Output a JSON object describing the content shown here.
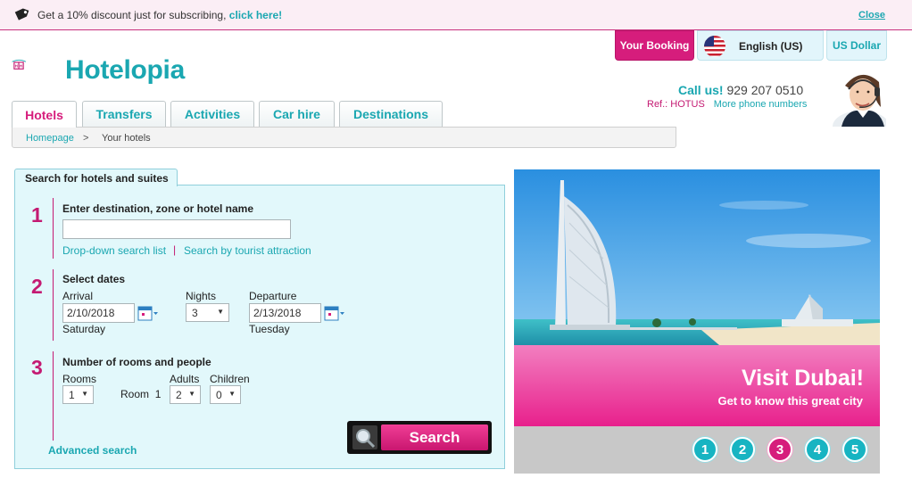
{
  "promo": {
    "text": "Get a 10% discount just for subscribing,",
    "link": "click here!",
    "close": "Close"
  },
  "brand": {
    "name": "Hotelopia"
  },
  "header": {
    "booking": "Your Booking",
    "language": "English (US)",
    "currency": "US Dollar",
    "call_label": "Call us!",
    "phone": "929 207 0510",
    "ref": "Ref.: HOTUS",
    "more_numbers": "More phone numbers"
  },
  "tabs": [
    "Hotels",
    "Transfers",
    "Activities",
    "Car hire",
    "Destinations"
  ],
  "breadcrumb": {
    "home": "Homepage",
    "sep": ">",
    "current": "Your hotels"
  },
  "search": {
    "tab_title": "Search for hotels and suites",
    "step1": {
      "num": "1",
      "title": "Enter destination, zone or hotel name",
      "value": "",
      "link1": "Drop-down search list",
      "divider": "|",
      "link2": "Search by tourist attraction"
    },
    "step2": {
      "num": "2",
      "title": "Select dates",
      "arrival_label": "Arrival",
      "arrival": "2/10/2018",
      "arrival_day": "Saturday",
      "nights_label": "Nights",
      "nights": "3",
      "departure_label": "Departure",
      "departure": "2/13/2018",
      "departure_day": "Tuesday"
    },
    "step3": {
      "num": "3",
      "title": "Number of rooms and people",
      "rooms_label": "Rooms",
      "rooms": "1",
      "room_label": "Room",
      "room_num": "1",
      "adults_label": "Adults",
      "adults": "2",
      "children_label": "Children",
      "children": "0"
    },
    "advanced": "Advanced search",
    "button": "Search"
  },
  "banner": {
    "title": "Visit Dubai!",
    "subtitle": "Get to know this great city",
    "pages": [
      "1",
      "2",
      "3",
      "4",
      "5"
    ],
    "active_page": 3
  },
  "colors": {
    "brand_teal": "#1aa7b1",
    "brand_pink": "#d61d7c",
    "panel_bg": "#e2f8fb"
  },
  "icons": [
    "price-tag-icon",
    "us-flag-icon",
    "calendar-icon",
    "magnifier-icon",
    "logo-icon",
    "support-agent-image"
  ]
}
